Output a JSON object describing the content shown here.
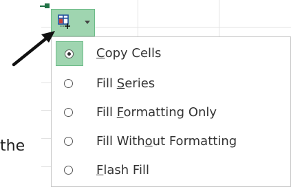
{
  "background_text": {
    "partial_word": "the"
  },
  "autofill_button": {
    "icon": "autofill-options-icon",
    "accent_color": "#9fd5b0"
  },
  "menu": {
    "items": [
      {
        "pre": "",
        "accel": "C",
        "post": "opy Cells",
        "selected": true
      },
      {
        "pre": "Fill ",
        "accel": "S",
        "post": "eries",
        "selected": false
      },
      {
        "pre": "Fill ",
        "accel": "F",
        "post": "ormatting Only",
        "selected": false
      },
      {
        "pre": "Fill With",
        "accel": "o",
        "post": "ut Formatting",
        "selected": false
      },
      {
        "pre": "",
        "accel": "F",
        "post": "lash Fill",
        "selected": false
      }
    ]
  },
  "annotation": {
    "icon": "pointer-arrow-icon",
    "color": "#111111"
  }
}
